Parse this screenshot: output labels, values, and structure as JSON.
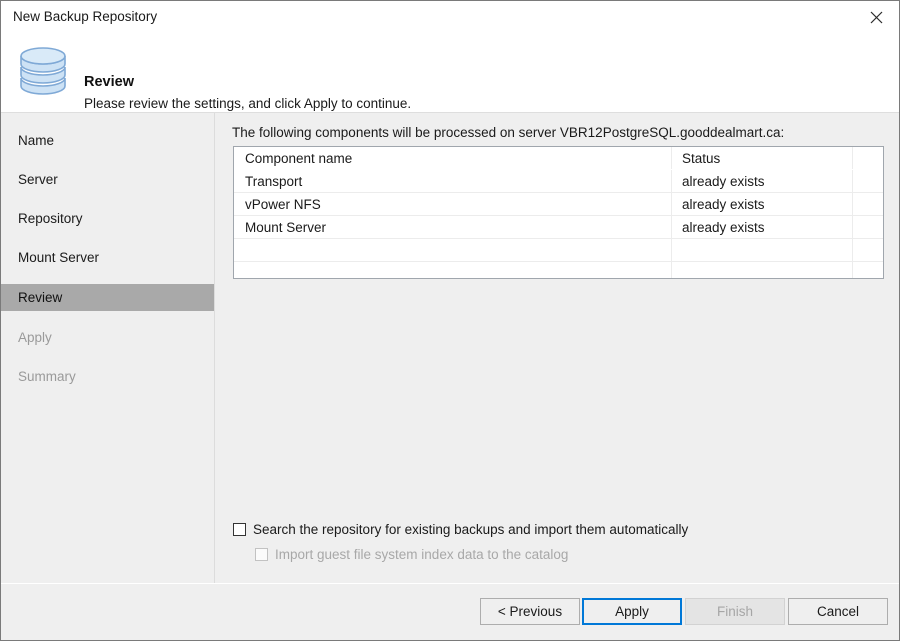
{
  "window": {
    "title": "New Backup Repository",
    "close_icon": "close-icon"
  },
  "header": {
    "icon": "database-repository-icon",
    "title": "Review",
    "subtitle": "Please review the settings, and click Apply to continue."
  },
  "sidebar": {
    "items": [
      {
        "label": "Name",
        "state": "normal"
      },
      {
        "label": "Server",
        "state": "normal"
      },
      {
        "label": "Repository",
        "state": "normal"
      },
      {
        "label": "Mount Server",
        "state": "normal"
      },
      {
        "label": "Review",
        "state": "selected"
      },
      {
        "label": "Apply",
        "state": "disabled"
      },
      {
        "label": "Summary",
        "state": "disabled"
      }
    ],
    "selected_color": "#a9a9a9"
  },
  "main": {
    "components_label": "The following components will be processed on server VBR12PostgreSQL.gooddealmart.ca:",
    "table": {
      "columns": [
        "Component name",
        "Status",
        ""
      ],
      "rows": [
        {
          "name": "Transport",
          "status": "already exists"
        },
        {
          "name": "vPower NFS",
          "status": "already exists"
        },
        {
          "name": "Mount Server",
          "status": "already exists"
        },
        {
          "name": "",
          "status": ""
        },
        {
          "name": "",
          "status": ""
        }
      ]
    },
    "options": {
      "search": {
        "label": "Search the repository for existing backups and import them automatically",
        "checked": false,
        "enabled": true
      },
      "import_index": {
        "label": "Import guest file system index data to the catalog",
        "checked": false,
        "enabled": false
      }
    }
  },
  "footer": {
    "previous_label": "< Previous",
    "apply_label": "Apply",
    "finish_label": "Finish",
    "cancel_label": "Cancel",
    "default_button": "Apply",
    "disabled_button": "Finish",
    "focus_color": "#0078d7"
  }
}
